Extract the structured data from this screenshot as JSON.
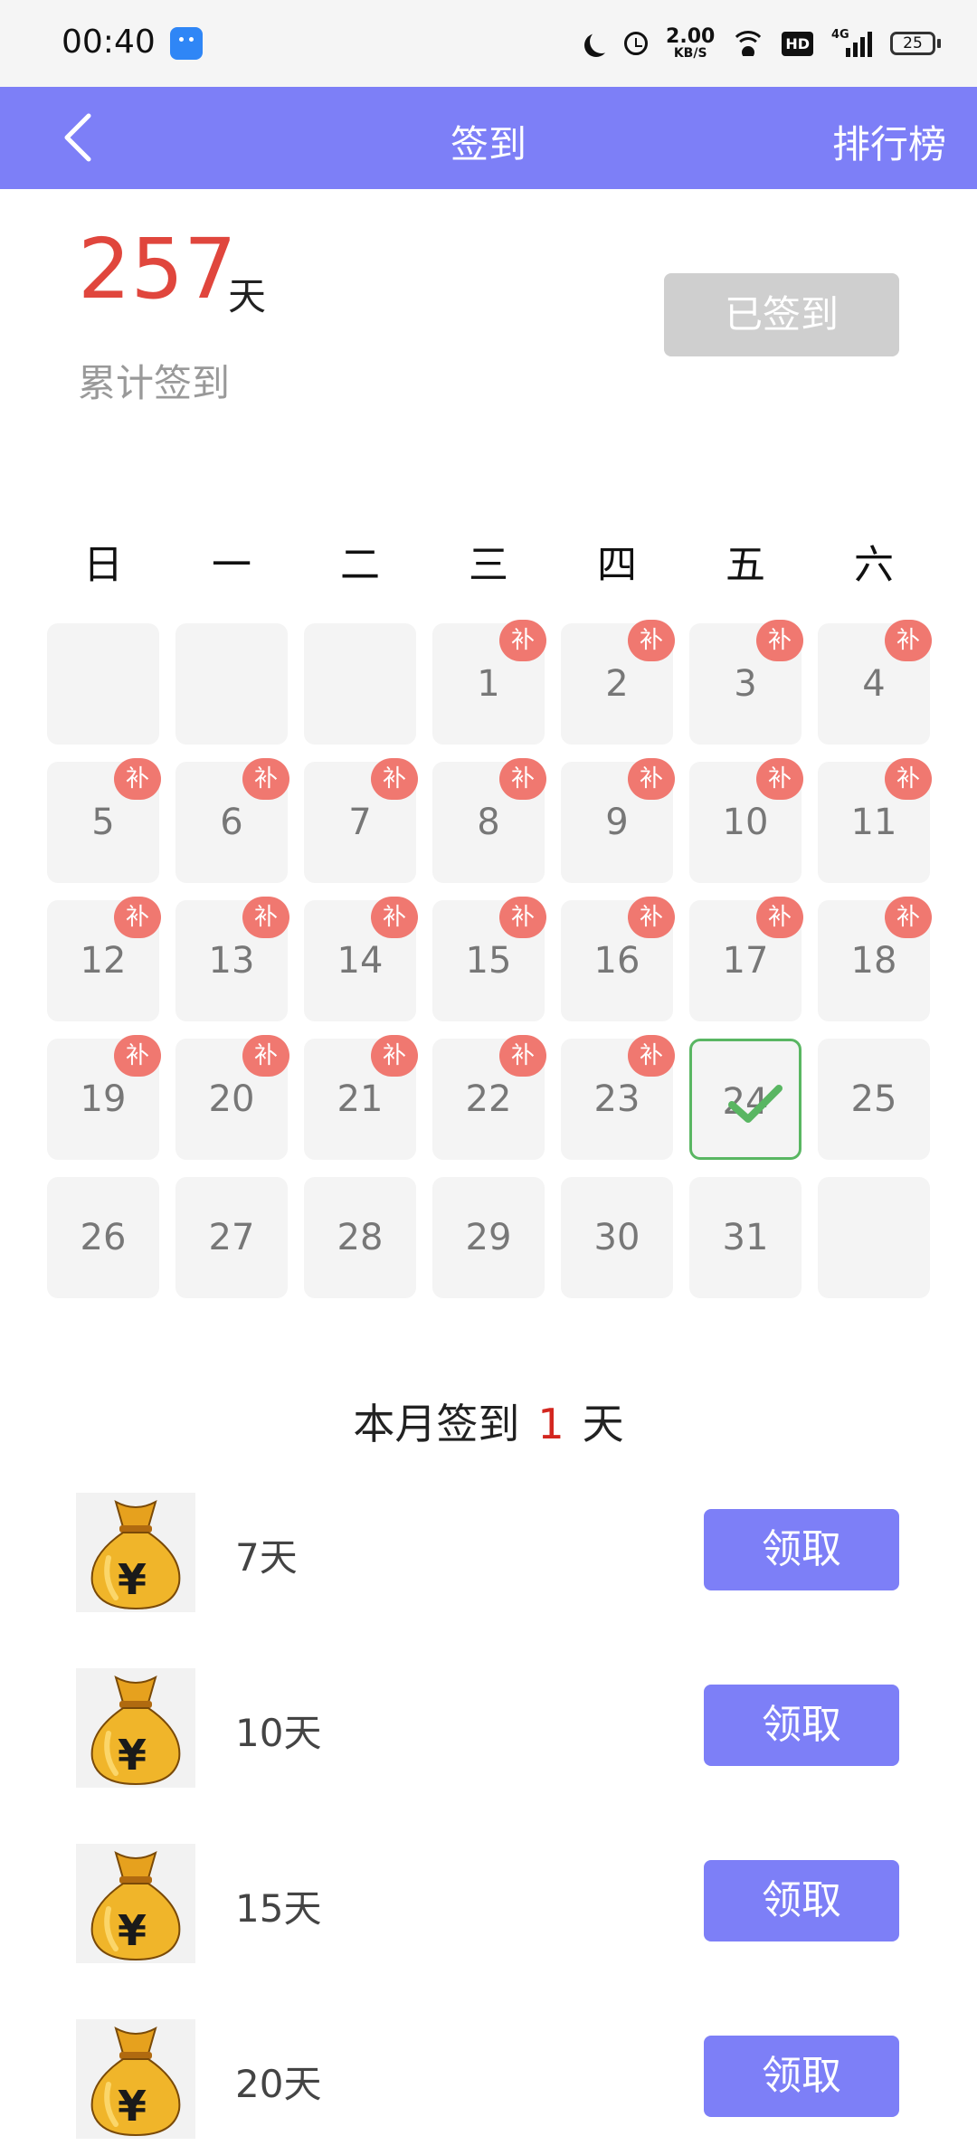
{
  "status_bar": {
    "time": "00:40",
    "speed_value": "2.00",
    "speed_unit": "KB/S",
    "hd": "HD",
    "network": "4G",
    "battery": "25"
  },
  "header": {
    "title": "签到",
    "right_action": "排行榜"
  },
  "summary": {
    "total_days": "257",
    "unit": "天",
    "label": "累计签到",
    "signed_button": "已签到"
  },
  "calendar": {
    "weekdays": [
      "日",
      "一",
      "二",
      "三",
      "四",
      "五",
      "六"
    ],
    "makeup_label": "补",
    "rows": [
      [
        "",
        "",
        "",
        "1",
        "2",
        "3",
        "4"
      ],
      [
        "5",
        "6",
        "7",
        "8",
        "9",
        "10",
        "11"
      ],
      [
        "12",
        "13",
        "14",
        "15",
        "16",
        "17",
        "18"
      ],
      [
        "19",
        "20",
        "21",
        "22",
        "23",
        "24",
        "25"
      ],
      [
        "26",
        "27",
        "28",
        "29",
        "30",
        "31",
        ""
      ]
    ],
    "today": "24"
  },
  "monthly": {
    "prefix": "本月签到",
    "count": "1",
    "suffix": "天"
  },
  "rewards": [
    {
      "label": "7天",
      "button": "领取"
    },
    {
      "label": "10天",
      "button": "领取"
    },
    {
      "label": "15天",
      "button": "领取"
    },
    {
      "label": "20天",
      "button": "领取"
    }
  ],
  "colors": {
    "primary": "#7d7ff7",
    "total_red": "#e0463d",
    "badge": "#f07870",
    "today_border": "#59b662",
    "signed_gray": "#cfcfcf"
  }
}
